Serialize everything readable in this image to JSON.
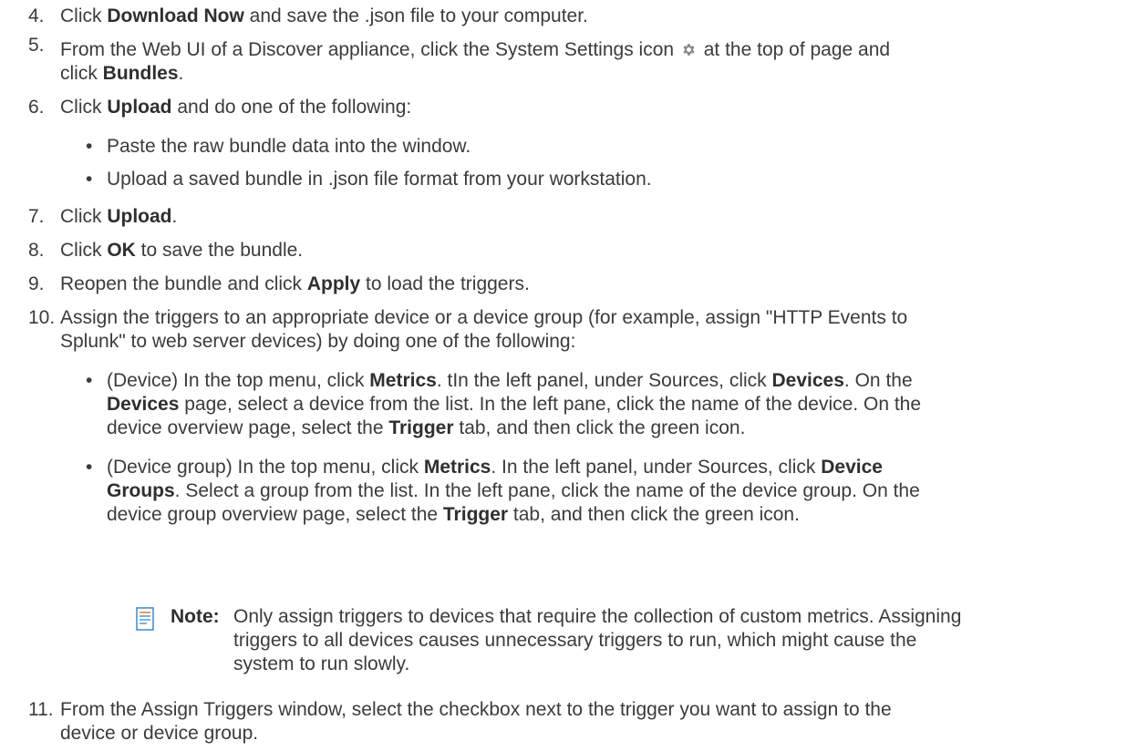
{
  "steps": [
    {
      "number": "4.",
      "t0": "Click ",
      "b0": "Download Now",
      "t1": " and save the .json file to your computer."
    },
    {
      "number": "5.",
      "line1": "From the Web UI of a Discover appliance, click the System Settings icon",
      "line1b": "at the top of page and",
      "line2_t0": "click ",
      "line2_b0": "Bundles",
      "line2_t1": "."
    },
    {
      "number": "6.",
      "t0": "Click ",
      "b0": "Upload",
      "t1": " and do one of the following:"
    },
    {
      "number": "7.",
      "t0": "Click ",
      "b0": "Upload",
      "t1": "."
    },
    {
      "number": "8.",
      "t0": "Click ",
      "b0": "OK",
      "t1": " to save the bundle."
    },
    {
      "number": "9.",
      "t0": "Reopen the bundle and click ",
      "b0": "Apply",
      "t1": " to load the triggers."
    },
    {
      "number": "10.",
      "line1": "Assign the triggers to an appropriate device or a device group (for example, assign \"HTTP Events to",
      "line2": "Splunk\" to web server devices) by doing one of the following:"
    },
    {
      "number": "11.",
      "line1": "From the Assign Triggers window, select the checkbox next to the trigger you want to assign to the",
      "line2": "device or device group."
    }
  ],
  "step6_bullets": [
    "Paste the raw bundle data into the window.",
    "Upload a saved bundle in .json file format from your workstation."
  ],
  "step10_bullets": {
    "device": {
      "l1_t0": "(Device) In the top menu, click ",
      "l1_b0": "Metrics",
      "l1_t1": ". tIn the left panel, under Sources, click ",
      "l1_b1": "Devices",
      "l1_t2": ". On the",
      "l2_b0": "Devices",
      "l2_t0": " page, select a device from the list. In the left pane, click the name of the device. On the",
      "l3_t0": "device overview page, select the ",
      "l3_b0": "Trigger",
      "l3_t1": " tab, and then click the green icon."
    },
    "group": {
      "l1_t0": "(Device group) In the top menu, click ",
      "l1_b0": "Metrics",
      "l1_t1": ". In the left panel, under Sources, click ",
      "l1_b1": "Device",
      "l2_b0": "Groups",
      "l2_t0": ". Select a group from the list. In the left pane, click the name of the device group. On the",
      "l3_t0": "device group overview page, select the ",
      "l3_b0": "Trigger",
      "l3_t1": " tab, and then click the green icon."
    }
  },
  "note": {
    "label": "Note:",
    "line1": "Only assign triggers to devices that require the collection of custom metrics. Assigning",
    "line2": "triggers to all devices causes unnecessary triggers to run, which might cause the",
    "line3": "system to run slowly."
  },
  "bullet_glyph": "•",
  "icons": {
    "settings": "gear-icon",
    "note": "note-icon"
  },
  "colors": {
    "text": "#3b3b3b",
    "gear": "#8a8a8a",
    "note_icon": "#4a90c8"
  }
}
